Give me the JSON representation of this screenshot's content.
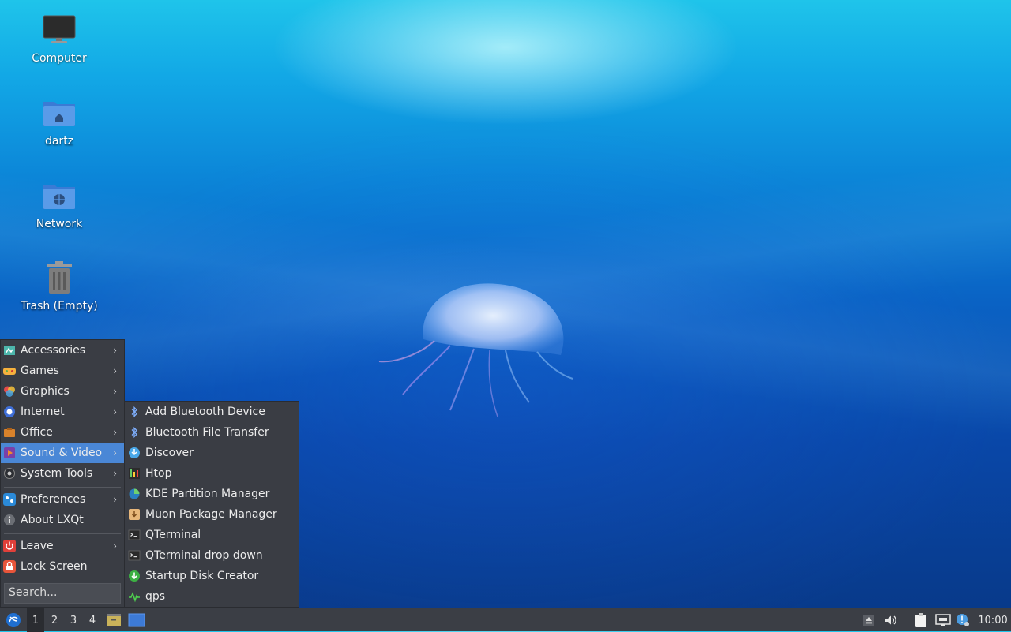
{
  "desktop": {
    "icons": [
      {
        "label": "Computer",
        "icon": "monitor-icon"
      },
      {
        "label": "dartz",
        "icon": "home-folder-icon"
      },
      {
        "label": "Network",
        "icon": "network-folder-icon"
      },
      {
        "label": "Trash (Empty)",
        "icon": "trash-icon"
      }
    ]
  },
  "menu": {
    "items": [
      {
        "label": "Accessories",
        "icon": "accessories-icon",
        "submenu": true
      },
      {
        "label": "Games",
        "icon": "games-icon",
        "submenu": true
      },
      {
        "label": "Graphics",
        "icon": "graphics-icon",
        "submenu": true
      },
      {
        "label": "Internet",
        "icon": "internet-icon",
        "submenu": true
      },
      {
        "label": "Office",
        "icon": "office-icon",
        "submenu": true
      },
      {
        "label": "Sound & Video",
        "icon": "sound-video-icon",
        "submenu": true,
        "active": true
      },
      {
        "label": "System Tools",
        "icon": "system-tools-icon",
        "submenu": true
      },
      {
        "label": "Preferences",
        "icon": "preferences-icon",
        "submenu": true
      },
      {
        "label": "About LXQt",
        "icon": "info-icon",
        "submenu": false
      },
      {
        "label": "Leave",
        "icon": "power-icon",
        "submenu": true
      },
      {
        "label": "Lock Screen",
        "icon": "lock-icon",
        "submenu": false
      }
    ],
    "search_placeholder": "Search..."
  },
  "submenu": {
    "items": [
      {
        "label": "Add Bluetooth Device",
        "icon": "bluetooth-icon"
      },
      {
        "label": "Bluetooth File Transfer",
        "icon": "bluetooth-icon"
      },
      {
        "label": "Discover",
        "icon": "discover-icon"
      },
      {
        "label": "Htop",
        "icon": "htop-icon"
      },
      {
        "label": "KDE Partition Manager",
        "icon": "partition-manager-icon"
      },
      {
        "label": "Muon Package Manager",
        "icon": "package-manager-icon"
      },
      {
        "label": "QTerminal",
        "icon": "terminal-icon"
      },
      {
        "label": "QTerminal drop down",
        "icon": "terminal-icon"
      },
      {
        "label": "Startup Disk Creator",
        "icon": "startup-disk-icon"
      },
      {
        "label": "qps",
        "icon": "qps-icon"
      }
    ]
  },
  "taskbar": {
    "workspaces": [
      "1",
      "2",
      "3",
      "4"
    ],
    "active_workspace": "1",
    "clock": "10:00"
  },
  "colors": {
    "menu_bg": "#3a3d44",
    "highlight": "#4a87d6",
    "taskbar_bg": "#3b3e45"
  }
}
